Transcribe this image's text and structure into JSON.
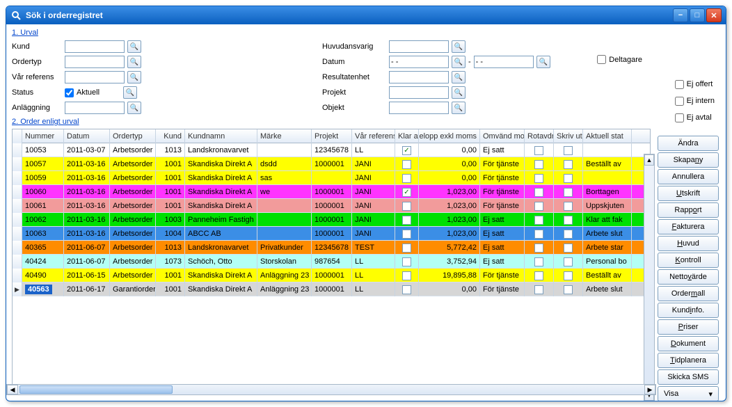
{
  "window": {
    "title": "Sök i orderregistret"
  },
  "sections": {
    "urval": "1. Urval",
    "order": "2. Order enligt urval"
  },
  "filters": {
    "kund": {
      "label": "Kund",
      "value": ""
    },
    "ordertyp": {
      "label": "Ordertyp",
      "value": ""
    },
    "varref": {
      "label": "Vår referens",
      "value": ""
    },
    "status": {
      "label": "Status",
      "aktuell_label": "Aktuell",
      "aktuell_checked": true
    },
    "anlaggning": {
      "label": "Anläggning",
      "value": ""
    },
    "huvudansvarig": {
      "label": "Huvudansvarig",
      "value": ""
    },
    "datum": {
      "label": "Datum",
      "from": "- -",
      "sep": "-",
      "to": "- -"
    },
    "resultatenhet": {
      "label": "Resultatenhet",
      "value": ""
    },
    "projekt": {
      "label": "Projekt",
      "value": ""
    },
    "objekt": {
      "label": "Objekt",
      "value": ""
    },
    "deltagare": {
      "label": "Deltagare",
      "checked": false
    },
    "ej_offert": {
      "label": "Ej offert",
      "checked": false
    },
    "ej_intern": {
      "label": "Ej intern",
      "checked": false
    },
    "ej_avtal": {
      "label": "Ej avtal",
      "checked": false
    }
  },
  "columns": [
    "Nummer",
    "Datum",
    "Ordertyp",
    "Kund",
    "Kundnamn",
    "Märke",
    "Projekt",
    "Vår referens",
    "Klar at",
    "Belopp exkl moms",
    "Omvänd mo",
    "Rotavdr",
    "Skriv ut",
    "Aktuell stat"
  ],
  "rows": [
    {
      "color": "#ffffff",
      "nummer": "10053",
      "datum": "2011-03-07",
      "ordertyp": "Arbetsorder",
      "kund": "1013",
      "kundnamn": "Landskronavarvet",
      "marke": "",
      "projekt": "12345678",
      "varref": "LL",
      "klar": true,
      "belopp": "0,00",
      "omvand": "Ej satt",
      "rot": false,
      "skriv": false,
      "status": ""
    },
    {
      "color": "#ffff00",
      "nummer": "10057",
      "datum": "2011-03-16",
      "ordertyp": "Arbetsorder",
      "kund": "1001",
      "kundnamn": "Skandiska Direkt A",
      "marke": "dsdd",
      "projekt": "1000001",
      "varref": "JANI",
      "klar": false,
      "belopp": "0,00",
      "omvand": "För tjänste",
      "rot": false,
      "skriv": false,
      "status": "Beställt av"
    },
    {
      "color": "#ffff00",
      "nummer": "10059",
      "datum": "2011-03-16",
      "ordertyp": "Arbetsorder",
      "kund": "1001",
      "kundnamn": "Skandiska Direkt A",
      "marke": "sas",
      "projekt": "",
      "varref": "JANI",
      "klar": false,
      "belopp": "0,00",
      "omvand": "För tjänste",
      "rot": false,
      "skriv": false,
      "status": ""
    },
    {
      "color": "#ff33ff",
      "nummer": "10060",
      "datum": "2011-03-16",
      "ordertyp": "Arbetsorder",
      "kund": "1001",
      "kundnamn": "Skandiska Direkt A",
      "marke": "we",
      "projekt": "1000001",
      "varref": "JANI",
      "klar": true,
      "belopp": "1,023,00",
      "omvand": "För tjänste",
      "rot": false,
      "skriv": false,
      "status": "Borttagen"
    },
    {
      "color": "#f29b9b",
      "nummer": "10061",
      "datum": "2011-03-16",
      "ordertyp": "Arbetsorder",
      "kund": "1001",
      "kundnamn": "Skandiska Direkt A",
      "marke": "",
      "projekt": "1000001",
      "varref": "JANI",
      "klar": false,
      "belopp": "1,023,00",
      "omvand": "För tjänste",
      "rot": false,
      "skriv": false,
      "status": "Uppskjuten"
    },
    {
      "color": "#00e000",
      "nummer": "10062",
      "datum": "2011-03-16",
      "ordertyp": "Arbetsorder",
      "kund": "1003",
      "kundnamn": "Panneheim Fastigh",
      "marke": "",
      "projekt": "1000001",
      "varref": "JANI",
      "klar": false,
      "belopp": "1,023,00",
      "omvand": "Ej satt",
      "rot": false,
      "skriv": false,
      "status": "Klar att fak"
    },
    {
      "color": "#3b8ee6",
      "nummer": "10063",
      "datum": "2011-03-16",
      "ordertyp": "Arbetsorder",
      "kund": "1004",
      "kundnamn": "ABCC AB",
      "marke": "",
      "projekt": "1000001",
      "varref": "JANI",
      "klar": false,
      "belopp": "1,023,00",
      "omvand": "Ej satt",
      "rot": false,
      "skriv": false,
      "status": "Arbete slut"
    },
    {
      "color": "#ff8c00",
      "nummer": "40365",
      "datum": "2011-06-07",
      "ordertyp": "Arbetsorder",
      "kund": "1013",
      "kundnamn": "Landskronavarvet",
      "marke": "Privatkunder",
      "projekt": "12345678",
      "varref": "TEST",
      "klar": false,
      "belopp": "5,772,42",
      "omvand": "Ej satt",
      "rot": false,
      "skriv": false,
      "status": "Arbete star"
    },
    {
      "color": "#b3fff5",
      "nummer": "40424",
      "datum": "2011-06-07",
      "ordertyp": "Arbetsorder",
      "kund": "1073",
      "kundnamn": "Schöch, Otto",
      "marke": "Storskolan",
      "projekt": "987654",
      "varref": "LL",
      "klar": false,
      "belopp": "3,752,94",
      "omvand": "Ej satt",
      "rot": false,
      "skriv": false,
      "status": "Personal bo"
    },
    {
      "color": "#ffff00",
      "nummer": "40490",
      "datum": "2011-06-15",
      "ordertyp": "Arbetsorder",
      "kund": "1001",
      "kundnamn": "Skandiska Direkt A",
      "marke": "Anläggning 23",
      "projekt": "1000001",
      "varref": "LL",
      "klar": false,
      "belopp": "19,895,88",
      "omvand": "För tjänste",
      "rot": false,
      "skriv": false,
      "status": "Beställt av"
    },
    {
      "color": "#d6d6d6",
      "selected": true,
      "nummer": "40563",
      "datum": "2011-06-17",
      "ordertyp": "Garantiorder",
      "kund": "1001",
      "kundnamn": "Skandiska Direkt A",
      "marke": "Anläggning 23",
      "projekt": "1000001",
      "varref": "LL",
      "klar": false,
      "belopp": "0,00",
      "omvand": "För tjänste",
      "rot": false,
      "skriv": false,
      "status": "Arbete slut"
    }
  ],
  "buttons": {
    "andra": "Ändra",
    "skapa": "Skapa ny",
    "annullera": "Annullera",
    "utskrift": "Utskrift",
    "rapport": "Rapport",
    "fakturera": "Fakturera",
    "huvud": "Huvud",
    "kontroll": "Kontroll",
    "nettovarde": "Nettovärde",
    "ordermall": "Ordermall",
    "kundinfo": "Kundinfo.",
    "priser": "Priser",
    "dokument": "Dokument",
    "tidplanera": "Tidplanera",
    "skicka": "Skicka SMS",
    "visa": "Visa"
  }
}
